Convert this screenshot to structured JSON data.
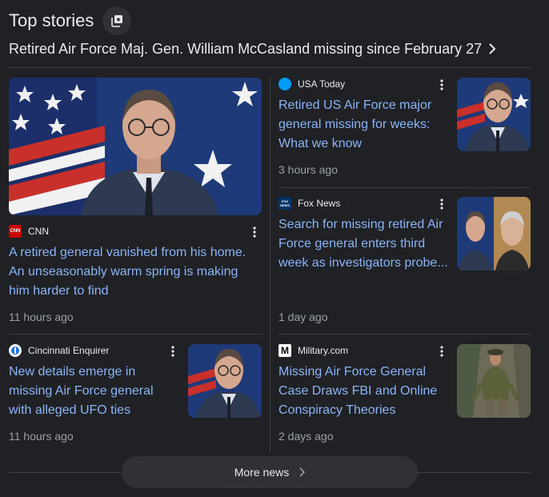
{
  "header": {
    "title": "Top stories",
    "icon": "stack-icon"
  },
  "headline": {
    "text": "Retired Air Force Maj. Gen. William McCasland missing since February 27",
    "icon": "chevron-right-icon"
  },
  "stories": [
    {
      "source": "CNN",
      "logo_text": "CNN",
      "logo_color": "#cc0000",
      "title": "A retired general vanished from his home. An unseasonably warm spring is making him harder to find",
      "time": "11 hours ago",
      "image": "general-portrait"
    },
    {
      "source": "USA Today",
      "logo_color": "#009bff",
      "title": "Retired US Air Force major general missing for weeks: What we know",
      "time": "3 hours ago",
      "image": "general-portrait"
    },
    {
      "source": "Fox News",
      "logo_text": "FOX NEWS",
      "logo_color": "#003366",
      "title": "Search for missing retired Air Force general enters third week as investigators probe...",
      "time": "1 day ago",
      "image": "split-portrait"
    },
    {
      "source": "Cincinnati Enquirer",
      "logo_color": "#ffffff",
      "title": "New details emerge in missing Air Force general with alleged UFO ties",
      "time": "11 hours ago",
      "image": "general-portrait"
    },
    {
      "source": "Military.com",
      "logo_text": "M",
      "logo_color": "#ffffff",
      "title": "Missing Air Force General Case Draws FBI and Online Conspiracy Theories",
      "time": "2 days ago",
      "image": "hiker-photo"
    }
  ],
  "more_news": {
    "label": "More news",
    "icon": "chevron-right-icon"
  },
  "colors": {
    "background": "#202124",
    "link": "#8ab4f8",
    "meta": "#9aa0a6",
    "divider": "#3c4043",
    "button": "#303134"
  }
}
